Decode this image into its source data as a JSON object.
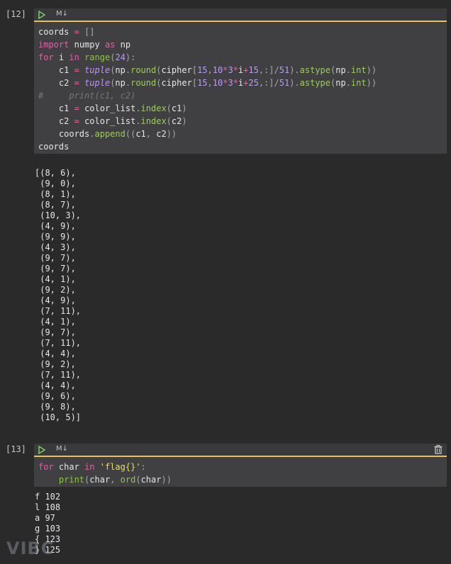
{
  "cell12": {
    "prompt": "[12]",
    "toolbar_label": "M↓",
    "code_lines_raw": [
      "coords = []",
      "import numpy as np",
      "for i in range(24):",
      "    c1 = tuple(np.round(cipher[15,10*3*i+15,:]/51).astype(np.int))",
      "    c2 = tuple(np.round(cipher[15,10*3*i+25,:]/51).astype(np.int))",
      "#     print(c1, c2)",
      "    c1 = color_list.index(c1)",
      "    c2 = color_list.index(c2)",
      "    coords.append((c1, c2))",
      "coords"
    ],
    "output": "[(8, 6),\n (9, 0),\n (8, 1),\n (8, 7),\n (10, 3),\n (4, 9),\n (9, 9),\n (4, 3),\n (9, 7),\n (9, 7),\n (4, 1),\n (9, 2),\n (4, 9),\n (7, 11),\n (4, 1),\n (9, 7),\n (7, 11),\n (4, 4),\n (9, 2),\n (7, 11),\n (4, 4),\n (9, 6),\n (9, 8),\n (10, 5)]"
  },
  "cell13": {
    "prompt": "[13]",
    "toolbar_label": "M↓",
    "code_lines_raw": [
      "for char in 'flag{}':",
      "    print(char, ord(char))"
    ],
    "output": "f 102\nl 108\na 97\ng 103\n{ 123\n} 125"
  },
  "watermark": "VIBC",
  "colors": {
    "accent_border": "#e8c15a",
    "keyword": "#e35ea5",
    "function": "#9dcc60",
    "number": "#b99cf2"
  },
  "icons": [
    "run-icon",
    "trash-icon"
  ]
}
